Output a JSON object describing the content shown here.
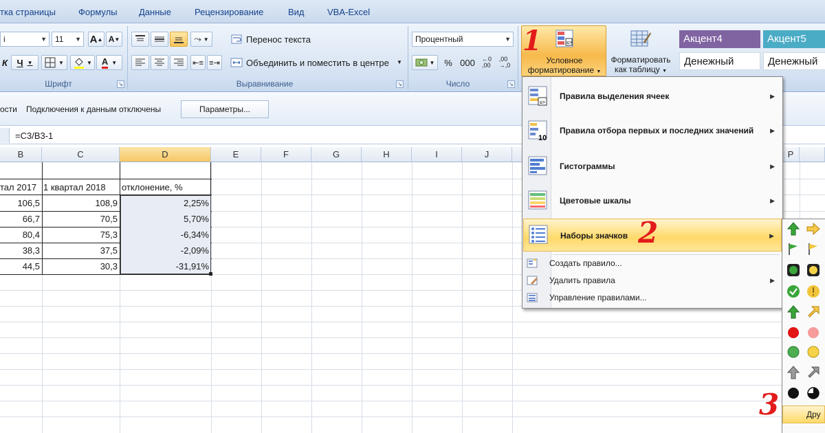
{
  "ribbon_tabs": [
    "тка страницы",
    "Формулы",
    "Данные",
    "Рецензирование",
    "Вид",
    "VBA-Excel"
  ],
  "font_group": {
    "font_name": "i",
    "font_size": "11",
    "grow_font": "A",
    "shrink_font": "A",
    "underline": "Ч",
    "label": "Шрифт"
  },
  "alignment_group": {
    "wrap_text": "Перенос текста",
    "merge_center": "Объединить и поместить в центре",
    "label": "Выравнивание"
  },
  "number_group": {
    "format": "Процентный",
    "percent": "%",
    "thousands": "000",
    "label": "Число"
  },
  "styles_group": {
    "conditional_formatting": [
      "Условное",
      "форматирование"
    ],
    "format_as_table": [
      "Форматировать",
      "как таблицу"
    ],
    "styles": [
      {
        "name": "Акцент4",
        "color": "#8064a2"
      },
      {
        "name": "Акцент5",
        "color": "#4bacc6"
      },
      {
        "name": "Денежный"
      },
      {
        "name": "Денежный"
      }
    ]
  },
  "message_bar": {
    "partial": "ости",
    "text": "Подключения к данным отключены",
    "button": "Параметры..."
  },
  "formula_bar": {
    "formula": "=C3/B3-1"
  },
  "grid": {
    "columns": [
      "B",
      "C",
      "D",
      "E",
      "F",
      "G",
      "H",
      "I",
      "J",
      "P"
    ],
    "selected_column": "D",
    "headers": [
      "тал 2017",
      "1 квартал 2018",
      "отклонение, %"
    ],
    "rows": [
      [
        "106,5",
        "108,9",
        "2,25%"
      ],
      [
        "66,7",
        "70,5",
        "5,70%"
      ],
      [
        "80,4",
        "75,3",
        "-6,34%"
      ],
      [
        "38,3",
        "37,5",
        "-2,09%"
      ],
      [
        "44,5",
        "30,3",
        "-31,91%"
      ]
    ]
  },
  "cf_menu": {
    "items": [
      "Правила выделения ячеек",
      "Правила отбора первых и последних значений",
      "Гистограммы",
      "Цветовые шкалы",
      "Наборы значков"
    ],
    "actions": [
      "Создать правило...",
      "Удалить правила",
      "Управление правилами..."
    ]
  },
  "icon_submenu": {
    "more_label": "Дру"
  },
  "annotations": [
    "1",
    "2",
    "3"
  ],
  "colors": {
    "highlight": "#ffd968",
    "annotation": "#e31b1b",
    "selection": "#f7c766"
  }
}
